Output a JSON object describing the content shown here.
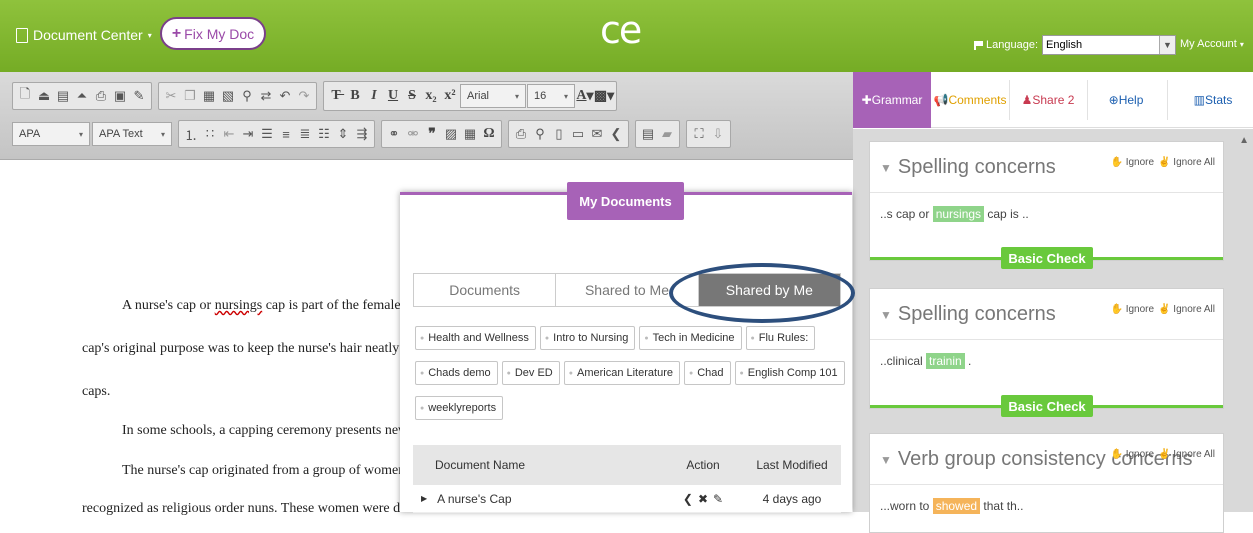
{
  "header": {
    "document_center": "Document Center",
    "fix_my_doc": "Fix My Doc",
    "logo": "ce",
    "language_label": "Language:",
    "language_value": "English",
    "my_account": "My Account"
  },
  "toolbar": {
    "font_name": "Arial",
    "font_size": "16",
    "style_select": "APA",
    "style_text_select": "APA Text"
  },
  "document": {
    "line1_a": "A nurse's cap or ",
    "line1_err": "nursings",
    "line1_b": " cap is part of the female nu",
    "line2": "cap's original purpose was to keep the nurse's hair neatly in p",
    "line3": "caps.",
    "line4": "In some schools, a capping ceremony presents new n",
    "line5": "The nurse's cap originated from a group of women in",
    "line6": "recognized as religious order nuns. These women were disti"
  },
  "panel": {
    "tabs": {
      "grammar": "Grammar",
      "comments": "Comments",
      "share": "Share 2",
      "help": "Help",
      "stats": "Stats"
    },
    "cards": [
      {
        "title": "Spelling concerns",
        "ignore": "Ignore",
        "ignore_all": "Ignore All",
        "snip_pre": "..s cap or ",
        "snip_hl": "nursings",
        "snip_post": " cap is ..",
        "button": "Basic Check"
      },
      {
        "title": "Spelling concerns",
        "ignore": "Ignore",
        "ignore_all": "Ignore All",
        "snip_pre": "..clinical ",
        "snip_hl": "trainin",
        "snip_post": " .",
        "button": "Basic Check"
      },
      {
        "title": "Verb group consistency concerns",
        "ignore": "Ignore",
        "ignore_all": "Ignore All",
        "snip_pre": "...worn to ",
        "snip_hl": "showed",
        "snip_post": " that th.."
      }
    ]
  },
  "modal": {
    "title": "My Documents",
    "tabs": [
      "Documents",
      "Shared to Me",
      "Shared by Me"
    ],
    "active_tab": "Shared by Me",
    "tags_row1": [
      "Health and Wellness",
      "Intro to Nursing",
      "Tech in Medicine",
      "Flu Rules:"
    ],
    "tags_row2": [
      "Chads demo",
      "Dev ED",
      "American Literature",
      "Chad",
      "English Comp 101"
    ],
    "tags_row3": [
      "weeklyreports"
    ],
    "table": {
      "headers": [
        "Document Name",
        "Action",
        "Last Modified"
      ],
      "rows": [
        {
          "name": "A nurse's Cap",
          "modified": "4 days ago"
        }
      ]
    }
  }
}
